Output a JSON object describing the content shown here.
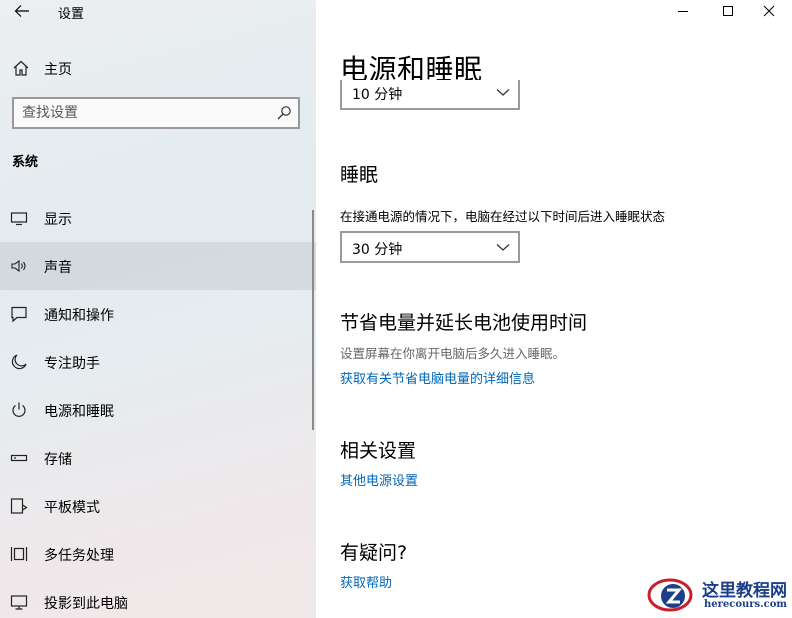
{
  "app": {
    "title": "设置"
  },
  "sidebar": {
    "home_label": "主页",
    "search_placeholder": "查找设置",
    "section_label": "系统",
    "items": [
      {
        "label": "显示",
        "icon": "display-icon"
      },
      {
        "label": "声音",
        "icon": "speaker-icon",
        "active": true
      },
      {
        "label": "通知和操作",
        "icon": "notification-icon"
      },
      {
        "label": "专注助手",
        "icon": "moon-icon"
      },
      {
        "label": "电源和睡眠",
        "icon": "power-icon"
      },
      {
        "label": "存储",
        "icon": "storage-icon"
      },
      {
        "label": "平板模式",
        "icon": "tablet-mode-icon"
      },
      {
        "label": "多任务处理",
        "icon": "multitasking-icon"
      },
      {
        "label": "投影到此电脑",
        "icon": "project-icon"
      }
    ]
  },
  "main": {
    "title": "电源和睡眠",
    "screen_dropdown_value": "10 分钟",
    "sleep": {
      "heading": "睡眠",
      "description": "在接通电源的情况下，电脑在经过以下时间后进入睡眠状态",
      "dropdown_value": "30 分钟"
    },
    "battery": {
      "heading": "节省电量并延长电池使用时间",
      "description": "设置屏幕在你离开电脑后多久进入睡眠。",
      "link": "获取有关节省电脑电量的详细信息"
    },
    "related": {
      "heading": "相关设置",
      "link": "其他电源设置"
    },
    "help": {
      "heading": "有疑问?",
      "link": "获取帮助"
    }
  },
  "watermark": {
    "title": "这里教程网",
    "subtitle": "herecours.com"
  },
  "colors": {
    "link": "#0067b8",
    "watermark": "#1d3f8a"
  }
}
